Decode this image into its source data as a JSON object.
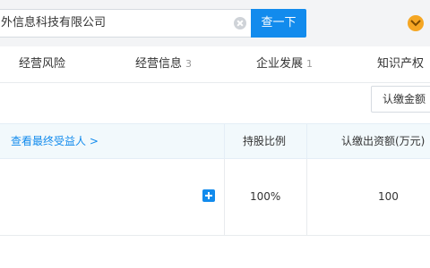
{
  "search": {
    "value": "外信息科技有限公司",
    "button_label": "查一下"
  },
  "tabs": [
    {
      "label": "经营风险",
      "count": ""
    },
    {
      "label": "经营信息",
      "count": "3"
    },
    {
      "label": "企业发展",
      "count": "1"
    },
    {
      "label": "知识产权",
      "count": ""
    }
  ],
  "sort_button": {
    "label": "认缴金额"
  },
  "table": {
    "beneficiary_link": "查看最终受益人 >",
    "headers": {
      "ratio": "持股比例",
      "amount": "认缴出资额(万元)"
    },
    "rows": [
      {
        "ratio": "100%",
        "amount": "100"
      }
    ]
  },
  "colors": {
    "accent": "#128bed",
    "header_bg": "#f3f4f6",
    "table_header_bg": "#f2f9fc",
    "user_icon": "#f5a623"
  },
  "icons": [
    "clear-icon",
    "chevron-down-icon",
    "plus-icon"
  ]
}
